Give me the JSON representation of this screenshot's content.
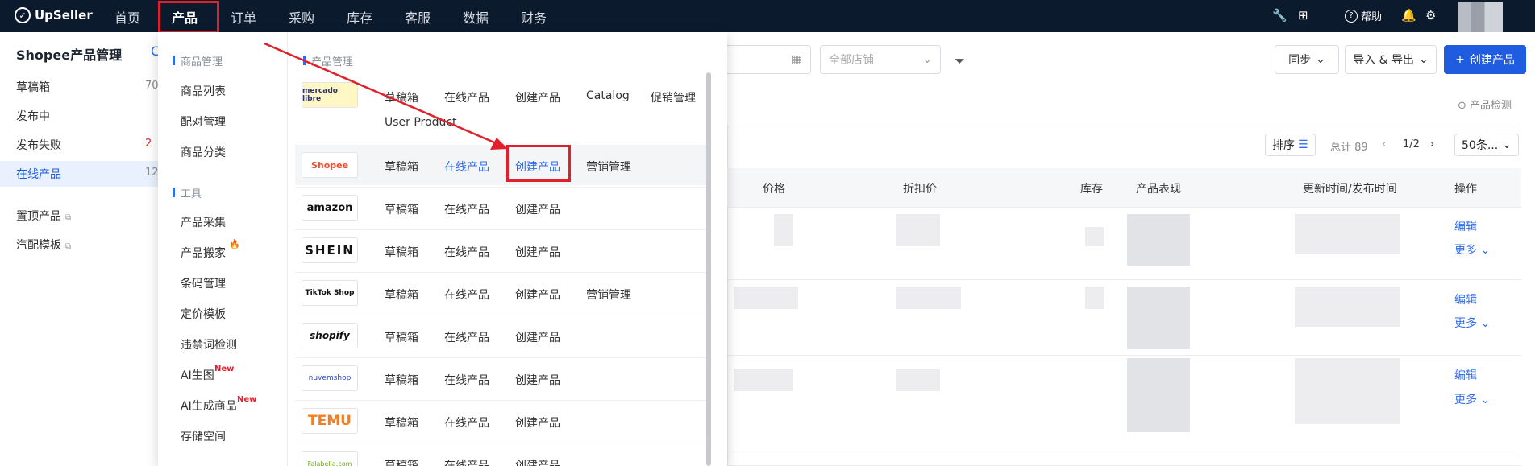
{
  "topnav": {
    "brand": "UpSeller",
    "items": [
      "首页",
      "产品",
      "订单",
      "采购",
      "库存",
      "客服",
      "数据",
      "财务"
    ],
    "active": "产品",
    "help_label": "帮助"
  },
  "sidebar": {
    "title": "Shopee产品管理",
    "items": [
      {
        "label": "草稿箱",
        "count": "70"
      },
      {
        "label": "发布中",
        "count": ""
      },
      {
        "label": "发布失败",
        "count": "2"
      },
      {
        "label": "在线产品",
        "count": "12"
      }
    ],
    "links": [
      "置顶产品",
      "汽配模板"
    ]
  },
  "dropdown": {
    "section_product": "商品管理",
    "product_items": [
      "商品列表",
      "配对管理",
      "商品分类"
    ],
    "section_tools": "工具",
    "tool_items": [
      "产品采集",
      "产品搬家",
      "条码管理",
      "定价模板",
      "违禁词检测",
      "AI生图",
      "AI生成商品",
      "存储空间"
    ],
    "new_badge": "New",
    "right_title": "产品管理",
    "platforms": [
      {
        "name": "mercado libre",
        "links": [
          "草稿箱",
          "在线产品",
          "创建产品",
          "Catalog",
          "促销管理",
          "User Product"
        ]
      },
      {
        "name": "Shopee",
        "links": [
          "草稿箱",
          "在线产品",
          "创建产品",
          "营销管理"
        ]
      },
      {
        "name": "amazon",
        "links": [
          "草稿箱",
          "在线产品",
          "创建产品"
        ]
      },
      {
        "name": "SHEIN",
        "links": [
          "草稿箱",
          "在线产品",
          "创建产品"
        ]
      },
      {
        "name": "TikTok Shop",
        "links": [
          "草稿箱",
          "在线产品",
          "创建产品",
          "营销管理"
        ]
      },
      {
        "name": "shopify",
        "links": [
          "草稿箱",
          "在线产品",
          "创建产品"
        ]
      },
      {
        "name": "nuvemshop",
        "links": [
          "草稿箱",
          "在线产品",
          "创建产品"
        ]
      },
      {
        "name": "TEMU",
        "links": [
          "草稿箱",
          "在线产品",
          "创建产品"
        ]
      },
      {
        "name": "Falabella.com",
        "links": [
          "草稿箱",
          "在线产品",
          "创建产品"
        ]
      }
    ]
  },
  "toolbar": {
    "store_placeholder": "全部店铺",
    "sync": "同步",
    "import_export": "导入 & 导出",
    "create": "创建产品",
    "check": "产品检测"
  },
  "pager": {
    "sort": "排序",
    "total": "总计 89",
    "page": "1/2",
    "per_page": "50条..."
  },
  "table": {
    "headers": [
      "价格",
      "折扣价",
      "库存",
      "产品表现",
      "更新时间/发布时间",
      "操作"
    ],
    "edit": "编辑",
    "more": "更多"
  }
}
